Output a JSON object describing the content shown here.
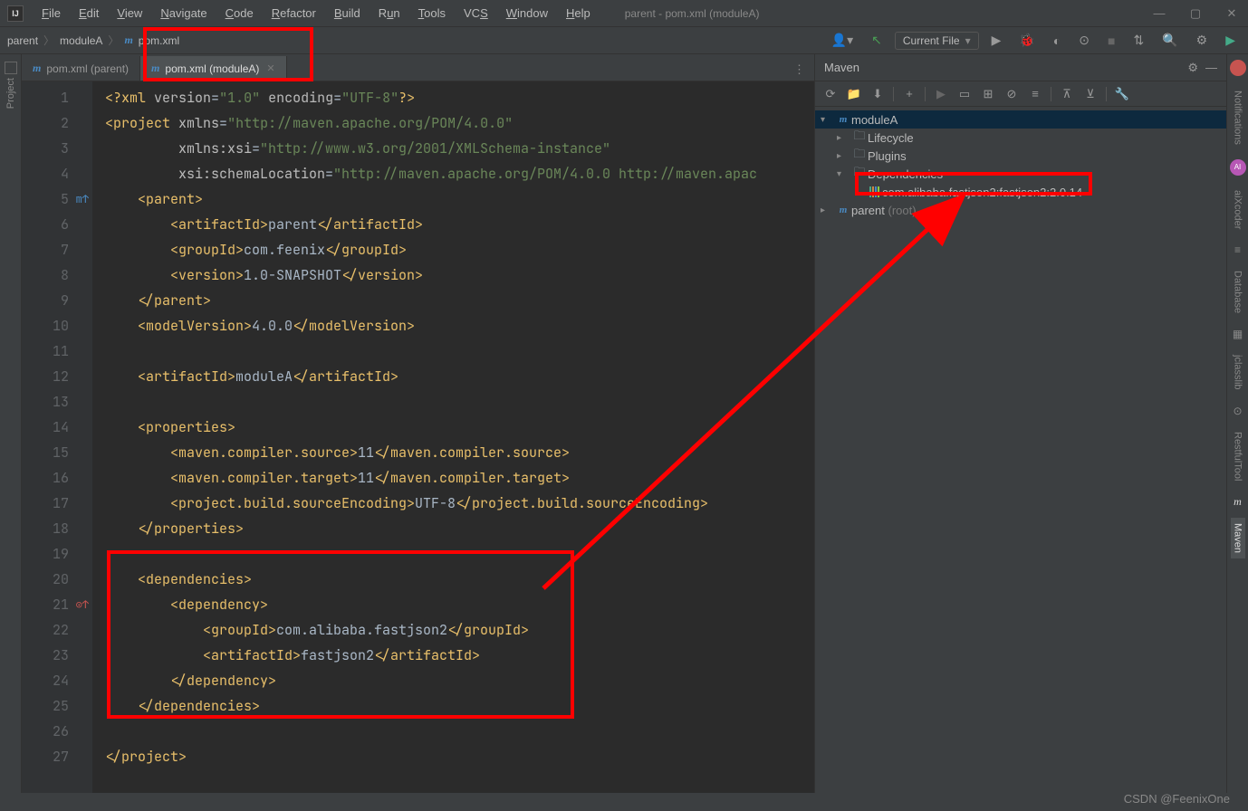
{
  "title_bar": {
    "logo": "IJ",
    "menus": [
      "File",
      "Edit",
      "View",
      "Navigate",
      "Code",
      "Refactor",
      "Build",
      "Run",
      "Tools",
      "VCS",
      "Window",
      "Help"
    ],
    "title": "parent - pom.xml (moduleA)"
  },
  "breadcrumbs": {
    "items": [
      "parent",
      "moduleA",
      "pom.xml"
    ]
  },
  "nav_right": {
    "current_file": "Current File"
  },
  "left_stripe": {
    "project": "Project"
  },
  "tabs": [
    {
      "label": "pom.xml (parent)",
      "active": false
    },
    {
      "label": "pom.xml (moduleA)",
      "active": true
    }
  ],
  "code": {
    "lines": [
      {
        "n": 1,
        "html": "<span class='t-pi'>&lt;?xml</span> <span class='t-attr'>version</span>=<span class='t-str'>\"1.0\"</span> <span class='t-attr'>encoding</span>=<span class='t-str'>\"UTF-8\"</span><span class='t-pi'>?&gt;</span>"
      },
      {
        "n": 2,
        "html": "<span class='t-tag'>&lt;project</span> <span class='t-attr'>xmlns</span>=<span class='t-str'>\"http://maven.apache.org/POM/4.0.0\"</span>"
      },
      {
        "n": 3,
        "html": "         <span class='t-attr'>xmlns:xsi</span>=<span class='t-str'>\"http://www.w3.org/2001/XMLSchema-instance\"</span>"
      },
      {
        "n": 4,
        "html": "         <span class='t-attr'>xsi:schemaLocation</span>=<span class='t-str'>\"http://maven.apache.org/POM/4.0.0 http://maven.apac</span>"
      },
      {
        "n": 5,
        "html": "    <span class='t-tag'>&lt;parent&gt;</span>",
        "icon": "m↑",
        "iconColor": "#4a8bc4"
      },
      {
        "n": 6,
        "html": "        <span class='t-tag'>&lt;artifactId&gt;</span>parent<span class='t-tag'>&lt;/artifactId&gt;</span>"
      },
      {
        "n": 7,
        "html": "        <span class='t-tag'>&lt;groupId&gt;</span>com.feenix<span class='t-tag'>&lt;/groupId&gt;</span>"
      },
      {
        "n": 8,
        "html": "        <span class='t-tag'>&lt;version&gt;</span>1.0-SNAPSHOT<span class='t-tag'>&lt;/version&gt;</span>"
      },
      {
        "n": 9,
        "html": "    <span class='t-tag'>&lt;/parent&gt;</span>"
      },
      {
        "n": 10,
        "html": "    <span class='t-tag'>&lt;modelVersion&gt;</span>4.0.0<span class='t-tag'>&lt;/modelVersion&gt;</span>"
      },
      {
        "n": 11,
        "html": ""
      },
      {
        "n": 12,
        "html": "    <span class='t-tag'>&lt;artifactId&gt;</span>moduleA<span class='t-tag'>&lt;/artifactId&gt;</span>"
      },
      {
        "n": 13,
        "html": ""
      },
      {
        "n": 14,
        "html": "    <span class='t-tag'>&lt;properties&gt;</span>"
      },
      {
        "n": 15,
        "html": "        <span class='t-tag'>&lt;maven.compiler.source&gt;</span>11<span class='t-tag'>&lt;/maven.compiler.source&gt;</span>"
      },
      {
        "n": 16,
        "html": "        <span class='t-tag'>&lt;maven.compiler.target&gt;</span>11<span class='t-tag'>&lt;/maven.compiler.target&gt;</span>"
      },
      {
        "n": 17,
        "html": "        <span class='t-tag'>&lt;project.build.sourceEncoding&gt;</span>UTF-8<span class='t-tag'>&lt;/project.build.sourceEncoding&gt;</span>"
      },
      {
        "n": 18,
        "html": "    <span class='t-tag'>&lt;/properties&gt;</span>"
      },
      {
        "n": 19,
        "html": ""
      },
      {
        "n": 20,
        "html": "    <span class='t-tag'>&lt;dependencies&gt;</span>"
      },
      {
        "n": 21,
        "html": "        <span class='t-tag'>&lt;dependency&gt;</span>",
        "icon": "⊙↑",
        "iconColor": "#c75450"
      },
      {
        "n": 22,
        "html": "            <span class='t-tag'>&lt;groupId&gt;</span>com.alibaba.fastjson2<span class='t-tag'>&lt;/groupId&gt;</span>"
      },
      {
        "n": 23,
        "html": "            <span class='t-tag'>&lt;artifactId&gt;</span>fastjson2<span class='t-tag'>&lt;/artifactId&gt;</span>"
      },
      {
        "n": 24,
        "html": "        <span class='t-tag'>&lt;/dependency&gt;</span>"
      },
      {
        "n": 25,
        "html": "    <span class='t-tag'>&lt;/dependencies&gt;</span>"
      },
      {
        "n": 26,
        "html": ""
      },
      {
        "n": 27,
        "html": "<span class='t-tag'>&lt;/project&gt;</span>"
      }
    ]
  },
  "maven": {
    "title": "Maven",
    "tree": {
      "moduleA": "moduleA",
      "lifecycle": "Lifecycle",
      "plugins": "Plugins",
      "dependencies": "Dependencies",
      "fastjson": "com.alibaba.fastjson2:fastjson2:2.0.14",
      "parent": "parent",
      "parent_suffix": "(root)"
    }
  },
  "right_stripe": {
    "items": [
      "Notifications",
      "aiXcoder",
      "Database",
      "jclasslib",
      "RestfulTool",
      "Maven"
    ]
  },
  "watermark": "CSDN @FeenixOne"
}
